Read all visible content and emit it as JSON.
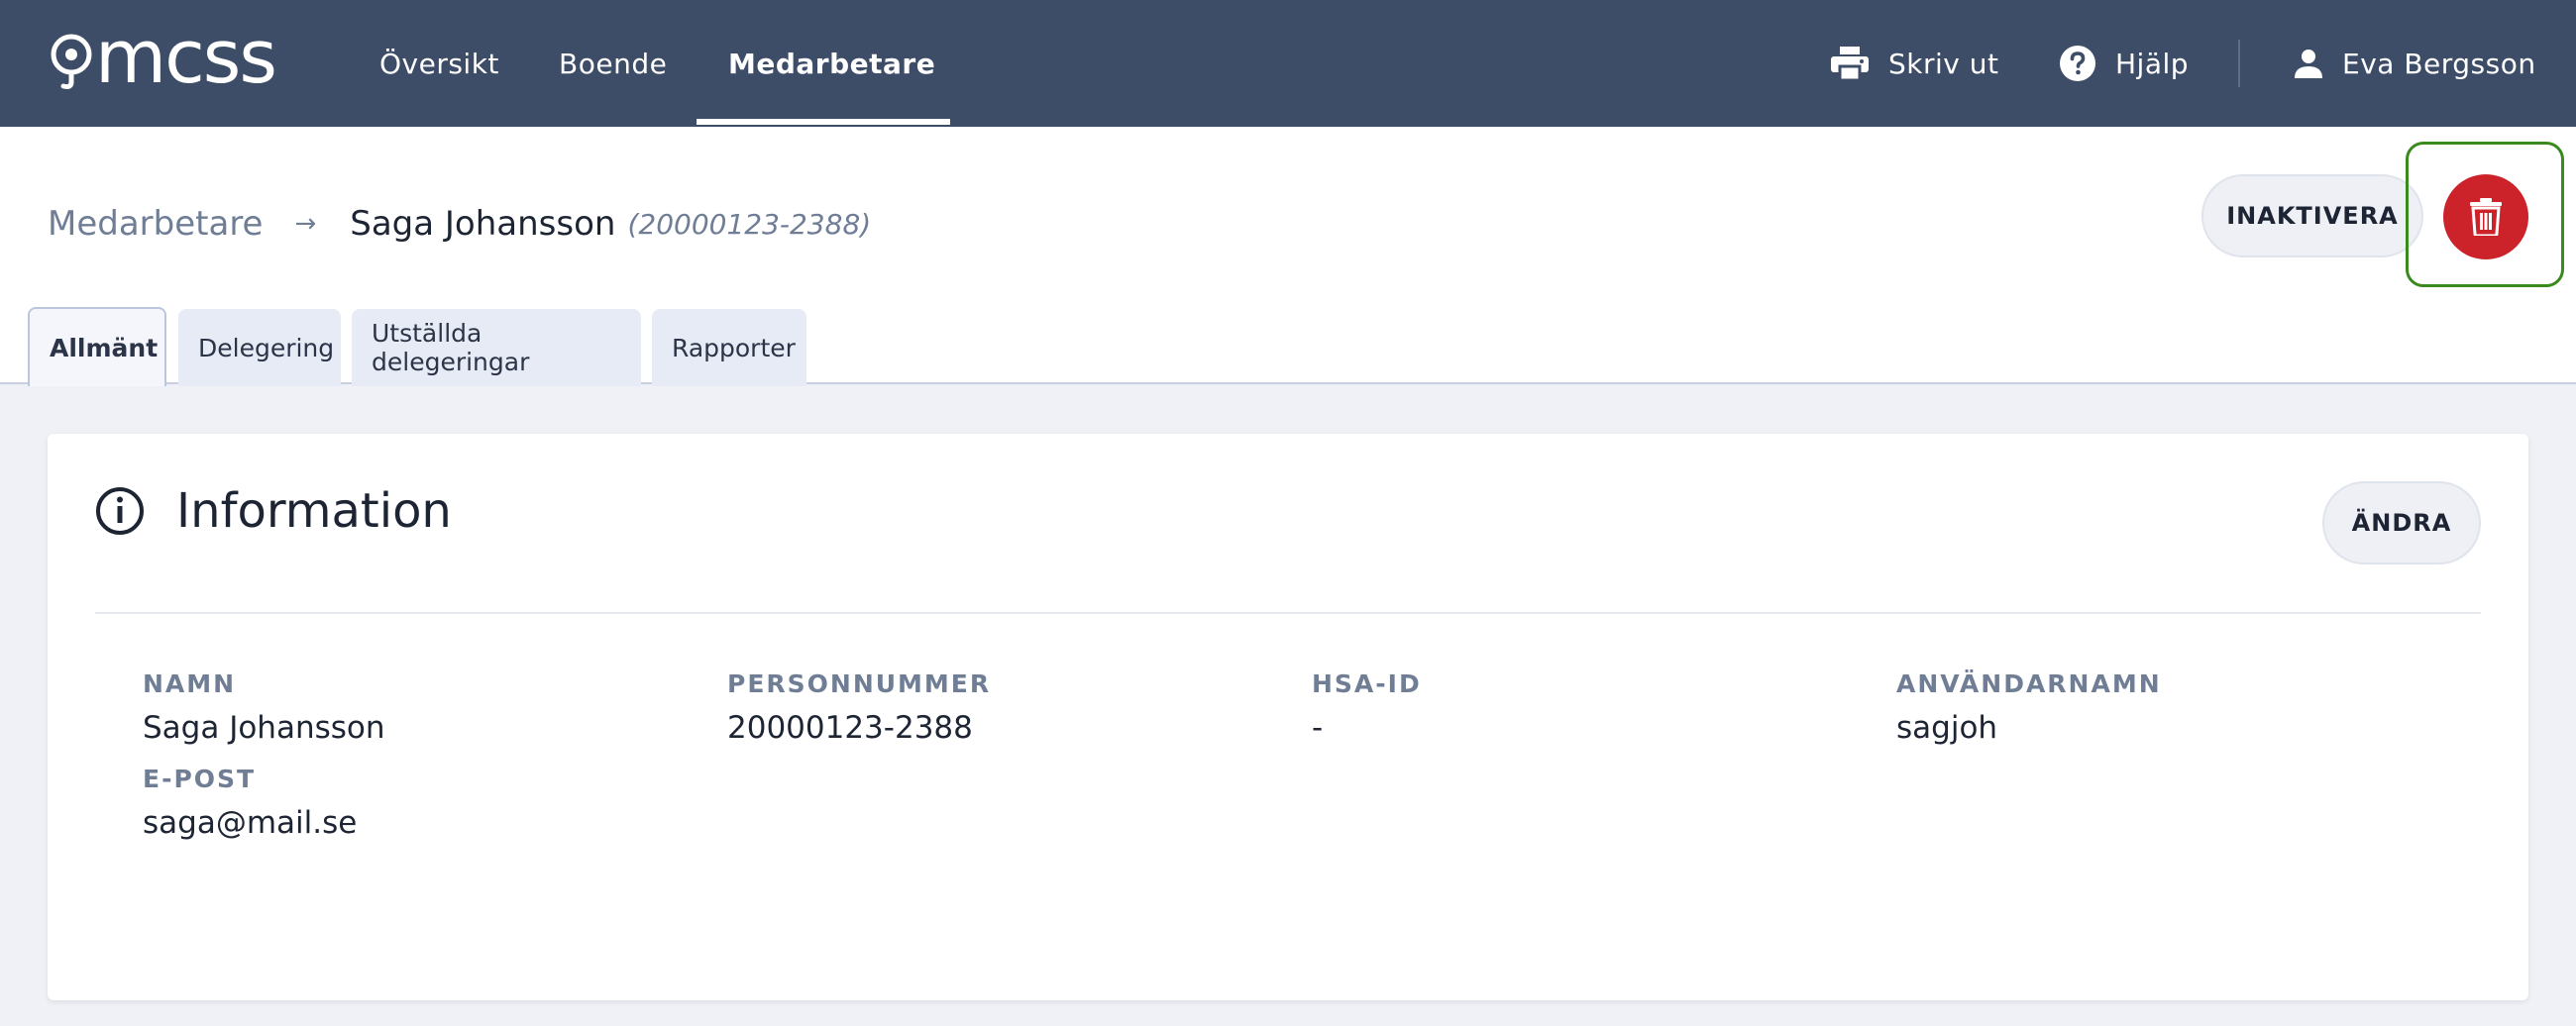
{
  "topbar": {
    "logo_text": "mcss",
    "nav": [
      {
        "label": "Översikt",
        "active": false
      },
      {
        "label": "Boende",
        "active": false
      },
      {
        "label": "Medarbetare",
        "active": true
      }
    ],
    "print_label": "Skriv ut",
    "help_label": "Hjälp",
    "user_name": "Eva Bergsson"
  },
  "breadcrumb": {
    "parent": "Medarbetare",
    "current": "Saga Johansson",
    "id": "(20000123-2388)"
  },
  "actions": {
    "inactivate_label": "INAKTIVERA"
  },
  "tabs": [
    {
      "label": "Allmänt",
      "active": true
    },
    {
      "label": "Delegering",
      "active": false
    },
    {
      "label": "Utställda delegeringar",
      "active": false
    },
    {
      "label": "Rapporter",
      "active": false
    }
  ],
  "card": {
    "title": "Information",
    "edit_label": "ÄNDRA",
    "fields": [
      {
        "label": "NAMN",
        "value": "Saga Johansson"
      },
      {
        "label": "PERSONNUMMER",
        "value": "20000123-2388"
      },
      {
        "label": "HSA-ID",
        "value": "-"
      },
      {
        "label": "ANVÄNDARNAMN",
        "value": "sagjoh"
      },
      {
        "label": "E-POST",
        "value": "saga@mail.se"
      }
    ]
  },
  "colors": {
    "topbar": "#3e4d67",
    "delete": "#cc2229",
    "focus_outline": "#3b8a1f"
  }
}
